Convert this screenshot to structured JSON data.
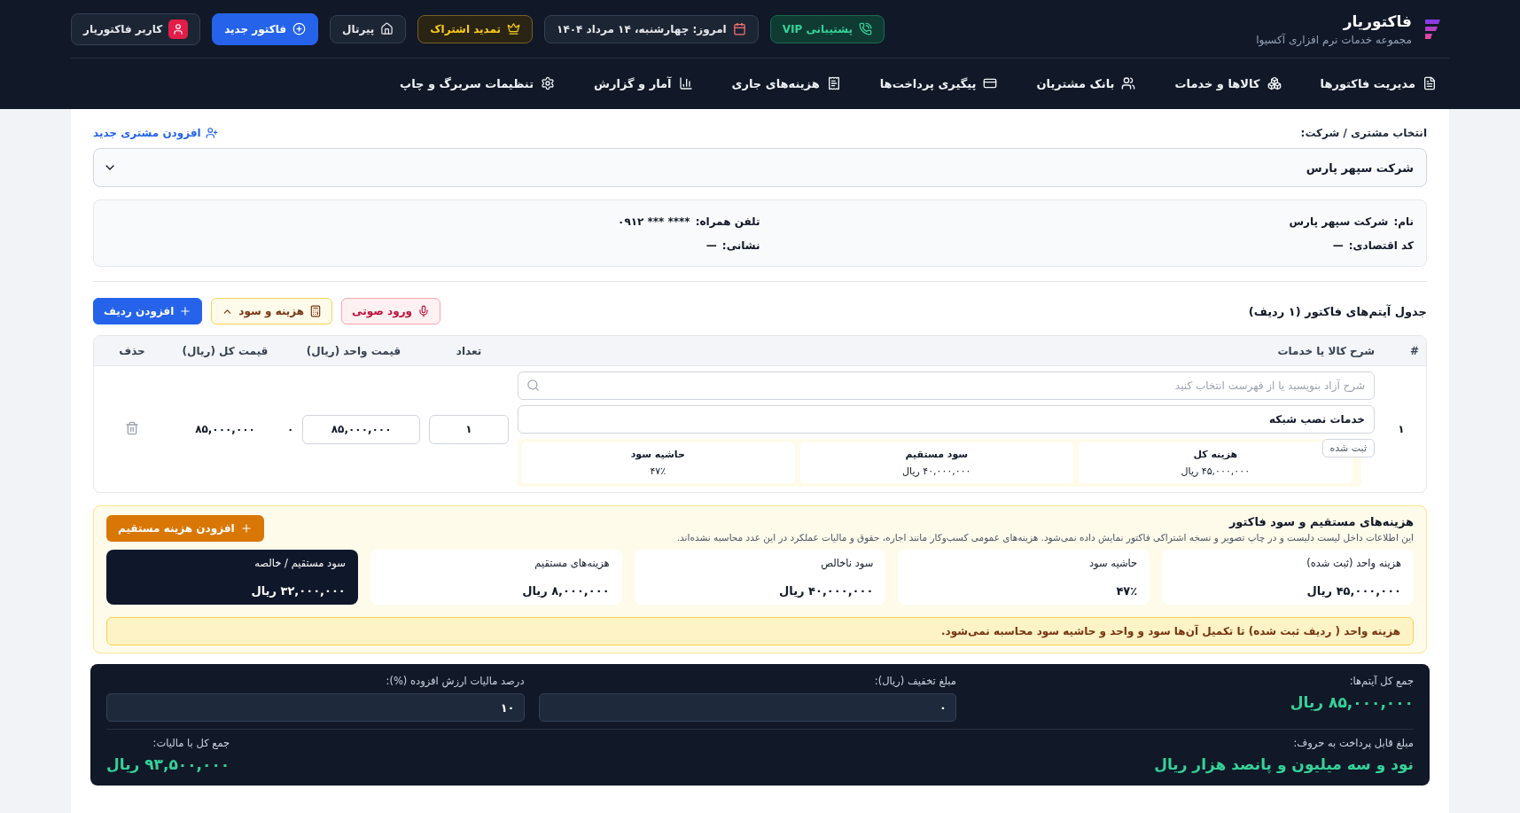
{
  "header": {
    "brand": {
      "title": "فاکتوریار",
      "subtitle": "مجموعه خدمات نرم افزاری آکسیوا"
    },
    "actions": [
      {
        "kind": "support",
        "label": "پشتیبانی VIP"
      },
      {
        "kind": "date",
        "label": "امروز: چهارشنبه، ۱۴ مرداد ۱۴۰۴"
      },
      {
        "kind": "renew",
        "label": "تمدید اشتراک"
      },
      {
        "kind": "portal",
        "label": "پیرتال"
      },
      {
        "kind": "new",
        "label": "فاکتور جدید"
      },
      {
        "kind": "user",
        "label": "کاربر فاکتوریار"
      }
    ],
    "nav": [
      "مدیریت فاکتورها",
      "کالاها و خدمات",
      "بانک مشتریان",
      "پیگیری پرداخت‌ها",
      "هزینه‌های جاری",
      "آمار و گزارش",
      "تنظیمات سربرگ و چاپ"
    ]
  },
  "customer": {
    "label": "انتخاب مشتری / شرکت:",
    "add_link": "افزودن مشتری جدید",
    "selected": "شرکت سپهر پارس",
    "info": {
      "name": {
        "label": "نام:",
        "value": "شرکت سپهر پارس"
      },
      "mobile": {
        "label": "تلفن همراه:",
        "value": "**** *** ۰۹۱۲"
      },
      "economic_code": {
        "label": "کد اقتصادی:",
        "value": "—"
      },
      "address": {
        "label": "نشانی:",
        "value": "—"
      }
    }
  },
  "items": {
    "title": "جدول آیتم‌های فاکتور (۱ ردیف)",
    "buttons": [
      {
        "kind": "voice",
        "label": "ورود صوتی"
      },
      {
        "kind": "cost",
        "label": "هزینه و سود"
      },
      {
        "kind": "add",
        "label": "افزودن ردیف"
      }
    ],
    "columns": [
      "#",
      "شرح کالا یا خدمات",
      "تعداد",
      "قیمت واحد (ریال)",
      "قیمت کل (ریال)",
      "حذف"
    ],
    "rows": [
      {
        "index": "۱",
        "search_placeholder": "شرح آزاد بنویسید یا از فهرست انتخاب کنید",
        "description": "خدمات نصب شبکه",
        "quantity": "۱",
        "unit_price": "۸۵,۰۰۰,۰۰۰",
        "unit_note": "۰",
        "total": "۸۵,۰۰۰,۰۰۰",
        "badge": "ثبت شده",
        "stats": [
          {
            "label": "هزینه کل",
            "value": "۴۵,۰۰۰,۰۰۰ ریال"
          },
          {
            "label": "سود مستقیم",
            "value": "۴۰,۰۰۰,۰۰۰ ریال"
          },
          {
            "label": "حاشیه سود",
            "value": "۴۷٪"
          }
        ]
      }
    ]
  },
  "costs": {
    "title": "هزینه‌های مستقیم و سود فاکتور",
    "description": "این اطلاعات داخل لیست دلیست و در چاپ تصویر و نسخه اشتراکی فاکتور نمایش داده نمی‌شود. هزینه‌های عمومی کسب‌وکار مانند اجاره، حقوق و مالیات عملکرد در این عدد محاسبه نشده‌اند.",
    "button": "افزودن هزینه مستقیم",
    "cards": [
      {
        "kind": "plain",
        "label": "هزینه واحد (ثبت شده)",
        "value": "۴۵,۰۰۰,۰۰۰ ریال"
      },
      {
        "kind": "plain",
        "label": "حاشیه سود",
        "value": "۴۷٪"
      },
      {
        "kind": "plain",
        "label": "سود ناخالص",
        "value": "۴۰,۰۰۰,۰۰۰ ریال"
      },
      {
        "kind": "plain",
        "label": "هزینه‌های مستقیم",
        "value": "۸,۰۰۰,۰۰۰ ریال"
      },
      {
        "kind": "highlight",
        "label": "سود مستقیم / خالصه",
        "value": "۳۲,۰۰۰,۰۰۰ ریال"
      }
    ],
    "warning": "هزینه واحد ( ردیف ثبت شده) تا تکمیل آن‌ها سود و واحد و حاشیه سود محاسبه نمی‌شود."
  },
  "totals": {
    "items_total": {
      "label": "جمع کل آیتم‌ها:",
      "value": "۸۵,۰۰۰,۰۰۰ ریال"
    },
    "discount": {
      "label": "مبلغ تخفیف (ریال):",
      "value": "۰"
    },
    "vat": {
      "label": "درصد مالیات ارزش افزوده (%):",
      "value": "۱۰"
    },
    "in_words": {
      "label": "مبلغ قابل پرداخت به حروف:",
      "value": "نود و سه میلیون و پانصد هزار ریال"
    },
    "grand_total": {
      "label": "جمع کل با مالیات:",
      "value": "۹۳,۵۰۰,۰۰۰ ریال"
    }
  }
}
